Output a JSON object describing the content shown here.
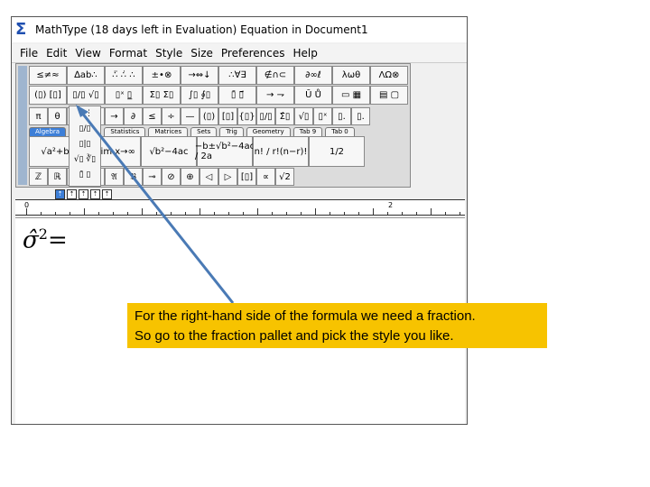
{
  "window": {
    "title": "MathType (18 days left in Evaluation)   Equation in Document1",
    "logo": "Σ"
  },
  "menu": [
    "File",
    "Edit",
    "View",
    "Format",
    "Style",
    "Size",
    "Preferences",
    "Help"
  ],
  "toolbar": {
    "row1": [
      "≤≠≈",
      "∆ab∴",
      "∴̈ ∴̇ ∴",
      "±•⊗",
      "→⇔↓",
      "∴∀∃",
      "∉∩⊂",
      "∂∞ℓ",
      "λωθ",
      "ΛΩ⊗"
    ],
    "row2": [
      "(▯) [▯]",
      "▯/▯ √▯",
      "▯ˣ ▯̲",
      "Σ▯ Σ▯",
      "∫▯ ∮▯",
      "▯̄ ▯⃗",
      "→ ⇁",
      "Ū Ů",
      "▭ ▦",
      "▤ ▢"
    ],
    "row3": [
      "π",
      "θ",
      "",
      "",
      "→",
      "∂",
      "≤",
      "÷",
      "—",
      "(▯)",
      "[▯]",
      "{▯}",
      "▯/▯",
      "Σ̂▯",
      "√▯",
      "▯ˣ",
      "▯.",
      "▯."
    ],
    "tabs": [
      "Algebra",
      "Derivs",
      "Statistics",
      "Matrices",
      "Sets",
      "Trig",
      "Geometry",
      "Tab 9",
      "Tab 0"
    ],
    "row4": [
      "√a²+b²",
      "▯ lim x→∞",
      "√b²−4ac",
      "−b±√b²−4ac / 2a",
      "n! / r!(n−r)!",
      "1/2"
    ],
    "row5": [
      "ℤ",
      "ℝ",
      "",
      "",
      "𝔄",
      "𝔅",
      "⊸",
      "⊘",
      "⊕",
      "◁",
      "▷",
      "[▯]",
      "∝",
      "√2"
    ],
    "dropdown": [
      "⋮⋮",
      "▯/▯",
      "▯|▯",
      "√▯ ∛▯",
      "▯̄ ▯"
    ]
  },
  "ruler": {
    "buttons": [
      "⇡",
      "⇡",
      "⇡",
      "⇡",
      "⇡"
    ],
    "labels": [
      "0",
      "2"
    ]
  },
  "document": {
    "equation_base": "σ̂",
    "equation_exp": "2",
    "equation_rest": "="
  },
  "callout": {
    "line1": "For the right-hand side of the formula we need a fraction.",
    "line2": "So go to the fraction pallet and pick the style you like.",
    "color": "#f7c300"
  },
  "arrow_color": "#4a7ab5"
}
